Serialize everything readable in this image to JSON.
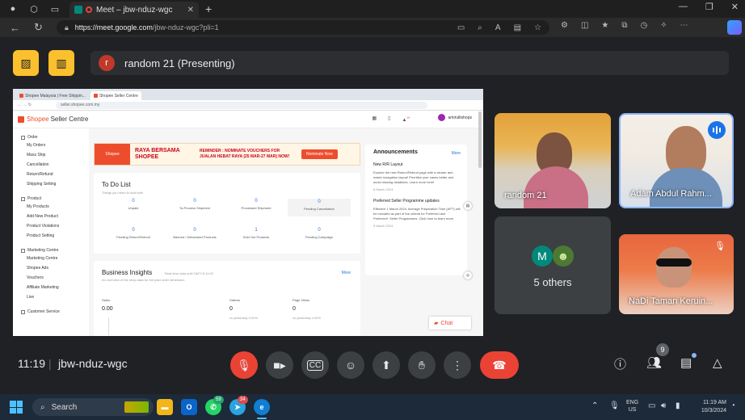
{
  "browser": {
    "tab_title": "Meet – jbw-nduz-wgc",
    "url_host": "https://meet.google.com",
    "url_path": "/jbw-nduz-wgc?pli=1"
  },
  "presenting": {
    "avatar_letter": "r",
    "label": "random 21 (Presenting)"
  },
  "shared_screen": {
    "tabs": [
      "Shopee Malaysia | Free Shippin...",
      "Shopee Seller Centre"
    ],
    "address": "seller.shopee.com.my",
    "logo": "Shopee",
    "logo_suffix": "Seller Centre",
    "username": "amirulitshops",
    "notif_count": "9+",
    "sidebar": [
      {
        "title": "Order",
        "items": [
          "My Orders",
          "Mass Ship",
          "Cancellation",
          "Return/Refund",
          "Shipping Setting"
        ]
      },
      {
        "title": "Product",
        "items": [
          "My Products",
          "Add New Product",
          "Product Violations",
          "Product Setting"
        ]
      },
      {
        "title": "Marketing Centre",
        "items": [
          "Marketing Centre",
          "Shopee Ads",
          "Vouchers",
          "Affiliate Marketing",
          "Live"
        ]
      },
      {
        "title": "Customer Service",
        "items": []
      }
    ],
    "banner": {
      "brand": "Shopee",
      "headline": "RAYA BERSAMA SHOPEE",
      "reminder": "REMINDER : NOMINATE VOUCHERS FOR JUALAN HEBAT RAYA (25 MAR-27 MAR) NOW!",
      "cta": "Nominate Now"
    },
    "todo": {
      "title": "To Do List",
      "subtitle": "Things you need to deal with",
      "cells": [
        {
          "n": "0",
          "l": "Unpaid"
        },
        {
          "n": "0",
          "l": "To-Process Shipment"
        },
        {
          "n": "0",
          "l": "Processed Shipment"
        },
        {
          "n": "0",
          "l": "Pending Cancellation"
        },
        {
          "n": "0",
          "l": "Pending Return/Refund"
        },
        {
          "n": "0",
          "l": "Banned / Deboosted Products"
        },
        {
          "n": "1",
          "l": "Sold Out Products"
        },
        {
          "n": "0",
          "l": "Pending Campaign"
        }
      ]
    },
    "insights": {
      "title": "Business Insights",
      "subtitle_inline": "Real-time data until GMT+8 11:00",
      "subtitle": "An overview of the shop data for the paid order dimension",
      "more": "More",
      "metrics": [
        {
          "label": "Sales",
          "value": "0.00",
          "sub": ""
        },
        {
          "label": "Visitors",
          "value": "0",
          "sub": "vs yesterday 0.00%"
        },
        {
          "label": "Page Views",
          "value": "0",
          "sub": "vs yesterday 0.00%"
        }
      ]
    },
    "announcements": {
      "title": "Announcements",
      "more": "More",
      "items": [
        {
          "h": "New R/R Layout",
          "p": "Explore the new Return/Refund page with a clearer and easier navigation layout! Prioritise your cases better and avoid missing deadlines. Learn more here!",
          "d": "8 March 2024"
        },
        {
          "h": "Preferred Seller Programme updates",
          "p": "Effective 1 March 2024, Average Preparation Time (APT) will be included as part of the criteria for Preferred and Preferred+ Seller Programmes. Click here to learn more.",
          "d": "5 March 2024"
        }
      ]
    },
    "chat_label": "Chat"
  },
  "participants": [
    {
      "name": "random 21"
    },
    {
      "name": "Adam Abdul Rahm..."
    },
    {
      "name": "NaDi Taman Keruin..."
    }
  ],
  "others": {
    "label": "5 others",
    "avatar_letter": "M"
  },
  "bottom": {
    "time": "11:19",
    "separator": "|",
    "meeting_code": "jbw-nduz-wgc",
    "people_count": "9"
  },
  "taskbar": {
    "search_placeholder": "Search",
    "badge_whatsapp": "59",
    "badge_telegram": "34",
    "lang_line1": "ENG",
    "lang_line2": "US",
    "time": "11:19 AM",
    "date": "10/3/2024"
  },
  "colors": {
    "meet_bg": "#202124",
    "control_gray": "#3c4043",
    "danger_red": "#ea4335",
    "accent_yellow": "#fbc02d",
    "shopee_orange": "#ee4d2d",
    "speaking_blue": "#1a73e8"
  }
}
